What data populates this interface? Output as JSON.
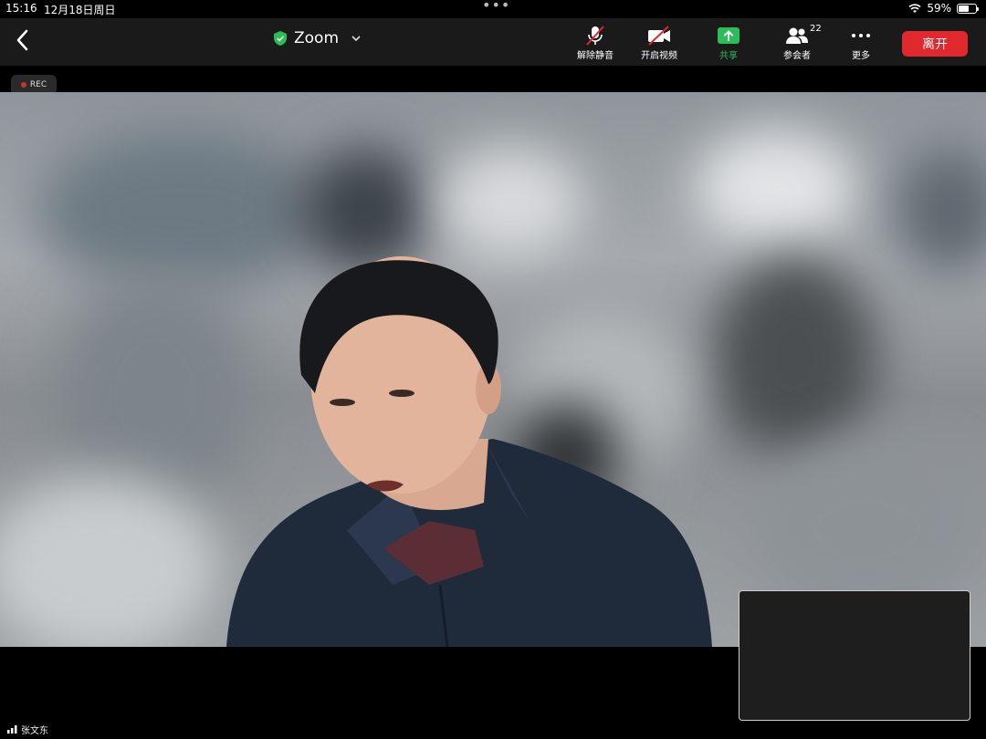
{
  "status_bar": {
    "time": "15:16",
    "date": "12月18日周日",
    "battery_percent": "59%",
    "battery_level": 0.59
  },
  "toolbar": {
    "title": "Zoom",
    "unmute_label": "解除静音",
    "start_video_label": "开启视频",
    "share_label": "共享",
    "participants_label": "参会者",
    "participants_count": "22",
    "more_label": "更多",
    "leave_label": "离开"
  },
  "recording": {
    "label": "REC"
  },
  "speaker": {
    "name": "张文东"
  },
  "colors": {
    "toolbar_bg": "#1a1a1a",
    "leave_red": "#e0282e",
    "share_green": "#2bbd58",
    "muted_red": "#e0282e"
  },
  "icons": [
    "back-chevron-icon",
    "shield-check-icon",
    "chevron-down-icon",
    "mic-muted-icon",
    "video-off-icon",
    "share-arrow-icon",
    "participants-icon",
    "more-dots-icon",
    "wifi-icon",
    "battery-icon",
    "signal-bars-icon"
  ]
}
